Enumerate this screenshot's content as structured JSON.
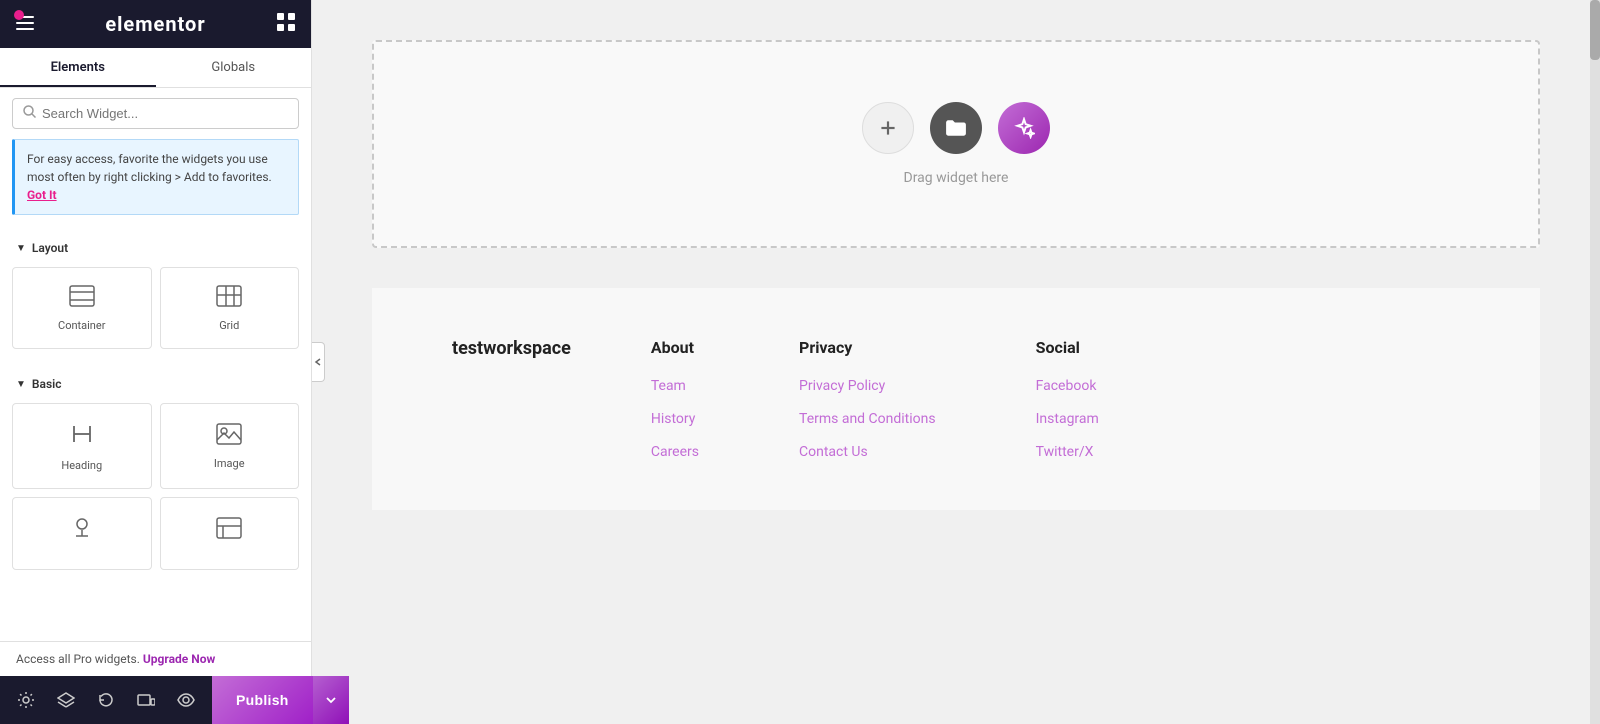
{
  "topbar": {
    "logo": "elementor",
    "menu_label": "menu",
    "grid_label": "grid"
  },
  "tabs": {
    "elements": "Elements",
    "globals": "Globals"
  },
  "search": {
    "placeholder": "Search Widget..."
  },
  "tip": {
    "text": "For easy access, favorite the widgets you use most often by right clicking > Add to favorites.",
    "link_text": "Got It"
  },
  "layout_section": {
    "label": "Layout",
    "widgets": [
      {
        "icon": "container",
        "label": "Container"
      },
      {
        "icon": "grid",
        "label": "Grid"
      }
    ]
  },
  "basic_section": {
    "label": "Basic",
    "widgets": [
      {
        "icon": "heading",
        "label": "Heading"
      },
      {
        "icon": "image",
        "label": "Image"
      },
      {
        "icon": "widget3",
        "label": ""
      },
      {
        "icon": "widget4",
        "label": ""
      }
    ]
  },
  "pro_bar": {
    "text": "Access all Pro widgets.",
    "link_text": "Upgrade Now"
  },
  "toolbar": {
    "settings_icon": "settings",
    "layers_icon": "layers",
    "history_icon": "history",
    "responsive_icon": "responsive",
    "preview_icon": "preview",
    "publish_label": "Publish",
    "chevron_label": "expand"
  },
  "canvas": {
    "drop_text": "Drag widget here"
  },
  "footer": {
    "brand": "testworkspace",
    "columns": [
      {
        "heading": "About",
        "links": [
          "Team",
          "History",
          "Careers"
        ]
      },
      {
        "heading": "Privacy",
        "links": [
          "Privacy Policy",
          "Terms and Conditions",
          "Contact Us"
        ]
      },
      {
        "heading": "Social",
        "links": [
          "Facebook",
          "Instagram",
          "Twitter/X"
        ]
      }
    ]
  },
  "colors": {
    "accent_purple": "#c36dd6",
    "accent_pink": "#e91e8c",
    "dark": "#1a1a2e"
  }
}
